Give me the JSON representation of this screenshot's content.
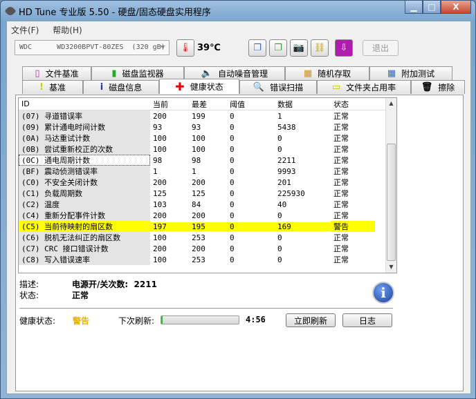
{
  "window": {
    "title": "HD Tune 专业版 5.50 - 硬盘/固态硬盘实用程序",
    "min": "▁",
    "max": "□",
    "close": "X"
  },
  "menu": [
    "文件(F)",
    "帮助(H)"
  ],
  "toolbar": {
    "drive": "WDC      WD3200BPVT-80ZES  (320 gB)",
    "temperature": "39℃",
    "exit": "退出"
  },
  "tabs_top": [
    "文件基准",
    "磁盘监视器",
    "自动噪音管理",
    "随机存取",
    "附加测试"
  ],
  "tabs_bottom": [
    "基准",
    "磁盘信息",
    "健康状态",
    "错误扫描",
    "文件夹占用率",
    "擦除"
  ],
  "table": {
    "headers": [
      "ID",
      "当前",
      "最差",
      "阈值",
      "数据",
      "状态"
    ],
    "rows": [
      [
        "(07) 寻道错误率",
        "200",
        "199",
        "0",
        "1",
        "正常"
      ],
      [
        "(09) 累计通电时间计数",
        "93",
        "93",
        "0",
        "5438",
        "正常"
      ],
      [
        "(0A) 马达重试计数",
        "100",
        "100",
        "0",
        "0",
        "正常"
      ],
      [
        "(0B) 尝试重新校正的次数",
        "100",
        "100",
        "0",
        "0",
        "正常"
      ],
      [
        "(0C) 通电周期计数",
        "98",
        "98",
        "0",
        "2211",
        "正常"
      ],
      [
        "(BF) 震动侦测错误率",
        "1",
        "1",
        "0",
        "9993",
        "正常"
      ],
      [
        "(C0) 不安全关闭计数",
        "200",
        "200",
        "0",
        "201",
        "正常"
      ],
      [
        "(C1) 负载周期数",
        "125",
        "125",
        "0",
        "225930",
        "正常"
      ],
      [
        "(C2) 温度",
        "103",
        "84",
        "0",
        "40",
        "正常"
      ],
      [
        "(C4) 重新分配事件计数",
        "200",
        "200",
        "0",
        "0",
        "正常"
      ],
      [
        "(C5) 当前待映射的扇区数",
        "197",
        "195",
        "0",
        "169",
        "警告"
      ],
      [
        "(C6) 脱机无法纠正的扇区数",
        "100",
        "253",
        "0",
        "0",
        "正常"
      ],
      [
        "(C7) CRC 接口错误计数",
        "200",
        "200",
        "0",
        "0",
        "正常"
      ],
      [
        "(C8) 写入错误速率",
        "100",
        "253",
        "0",
        "0",
        "正常"
      ]
    ],
    "selected_index": 4,
    "warning_index": 10
  },
  "detail": {
    "desc_label": "描述:",
    "desc_value": "电源开/关次数:  2211",
    "status_label": "状态:",
    "status_value": "正常"
  },
  "bottom": {
    "health_label": "健康状态:",
    "health_value": "警告",
    "health_color": "#e8b400",
    "refresh_label": "下次刷新:",
    "refresh_progress": 0.02,
    "countdown": "4:56",
    "refresh_now": "立即刷新",
    "log": "日志"
  }
}
